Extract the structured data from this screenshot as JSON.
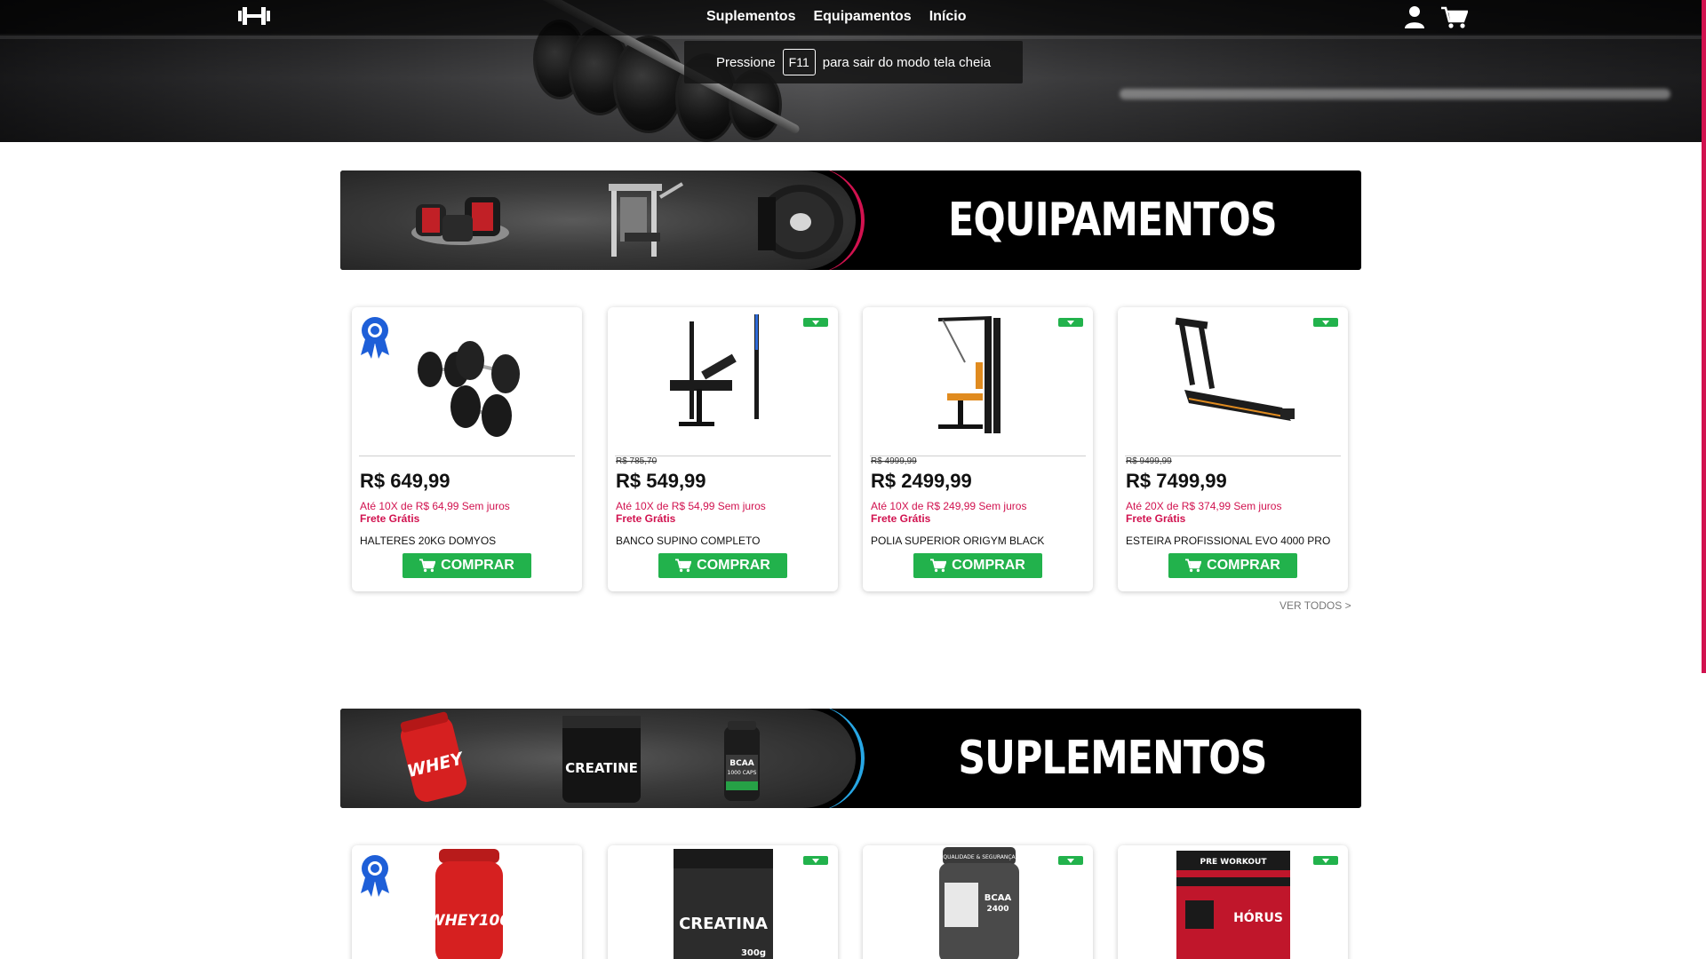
{
  "nav": {
    "links": [
      "Suplementos",
      "Equipamentos",
      "Início"
    ]
  },
  "fullscreen_toast": {
    "before": "Pressione",
    "key": "F11",
    "after": "para sair do modo tela cheia"
  },
  "sections": [
    {
      "title": "EQUIPAMENTOS",
      "accent": "#d1124f"
    },
    {
      "title": "SUPLEMENTOS",
      "accent": "#27a6e4"
    }
  ],
  "equipment": [
    {
      "old_price": "",
      "price": "R$ 649,99",
      "installments": "Até 10X de R$ 64,99 Sem juros",
      "shipping": "Frete Grátis",
      "name": "HALTERES 20KG DOMYOS",
      "buy_label": "COMPRAR"
    },
    {
      "old_price": "R$ 785,70",
      "price": "R$ 549,99",
      "installments": "Até 10X de R$ 54,99 Sem juros",
      "shipping": "Frete Grátis",
      "name": "BANCO SUPINO COMPLETO",
      "buy_label": "COMPRAR"
    },
    {
      "old_price": "R$ 4999,99",
      "price": "R$ 2499,99",
      "installments": "Até 10X de R$ 249,99 Sem juros",
      "shipping": "Frete Grátis",
      "name": "POLIA SUPERIOR ORIGYM BLACK",
      "buy_label": "COMPRAR"
    },
    {
      "old_price": "R$ 9499,99",
      "price": "R$ 7499,99",
      "installments": "Até 20X de R$ 374,99 Sem juros",
      "shipping": "Frete Grátis",
      "name": "ESTEIRA PROFISSIONAL EVO 4000 PRO",
      "buy_label": "COMPRAR"
    }
  ],
  "view_all": "VER TODOS >",
  "supplement_labels": {
    "whey": "WHEY",
    "creatine_banner": "CREATINE",
    "bcaa_banner": "BCAA",
    "bcaa_caps": "1000 CAPS",
    "whey_card": "WHEY100",
    "creatina_card": "CREATINA",
    "creatina_weight": "300g",
    "bcaa_card": "BCAA",
    "bcaa_card_num": "2400",
    "qa_brand": "QUALIDADE & SEGURANÇA",
    "preworkout": "PRE WORKOUT",
    "horus": "HÓRUS"
  },
  "colors": {
    "brand_accent": "#d1124f",
    "buy_button": "#22b24c",
    "ribbon_blue": "#1e5fd8"
  }
}
